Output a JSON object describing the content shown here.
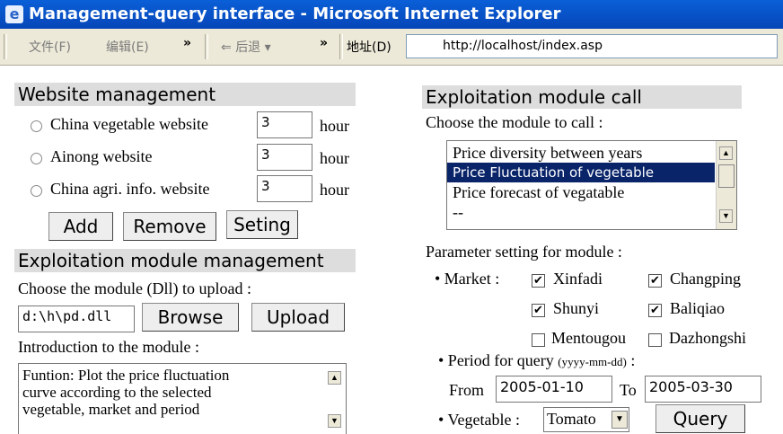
{
  "window": {
    "title": "Management-query interface - Microsoft Internet Explorer"
  },
  "toolbar": {
    "file_menu": "文件(F)",
    "edit_menu": "编辑(E)",
    "more1": "»",
    "back": "后退",
    "more2": "»",
    "address_label": "地址(D)",
    "address_value": "http://localhost/index.asp"
  },
  "website_mgmt": {
    "heading": "Website management",
    "sites": [
      {
        "label": "China vegetable website",
        "value": "3",
        "unit": "hour"
      },
      {
        "label": "Ainong website",
        "value": "3",
        "unit": "hour"
      },
      {
        "label": "China agri. info. website",
        "value": "3",
        "unit": "hour"
      }
    ],
    "add": "Add",
    "remove": "Remove",
    "setting": "Seting"
  },
  "module_mgmt": {
    "heading": "Exploitation module management",
    "choose_label": "Choose the module (Dll) to upload :",
    "file_value": "d:\\h\\pd.dll",
    "browse": "Browse",
    "upload": "Upload",
    "intro_label": "Introduction to the module :",
    "intro_lines": [
      "Funtion: Plot the price fluctuation",
      "curve according to the selected",
      "vegetable, market and period"
    ]
  },
  "module_call": {
    "heading": "Exploitation module call",
    "choose_label": "Choose the module to call :",
    "options": [
      "Price diversity between years",
      "Price Fluctuation of vegetable",
      "Price forecast of vegatable",
      "--"
    ],
    "param_label": "Parameter setting for module :",
    "market_label": "• Market :",
    "markets": [
      {
        "name": "Xinfadi",
        "checked": true
      },
      {
        "name": "Changping",
        "checked": true
      },
      {
        "name": "Shunyi",
        "checked": true
      },
      {
        "name": "Baliqiao",
        "checked": true
      },
      {
        "name": "Mentougou",
        "checked": false
      },
      {
        "name": "Dazhongshi",
        "checked": false
      }
    ],
    "period_label": "• Period for query",
    "period_format": "(yyyy-mm-dd)",
    "period_colon": ":",
    "from_label": "From",
    "from_value": "2005-01-10",
    "to_label": "To",
    "to_value": "2005-03-30",
    "vegetable_label": "• Vegetable :",
    "vegetable_value": "Tomato",
    "query": "Query"
  },
  "colors": {
    "titlebar": "#0a5fd8",
    "selected": "#0a246a"
  }
}
